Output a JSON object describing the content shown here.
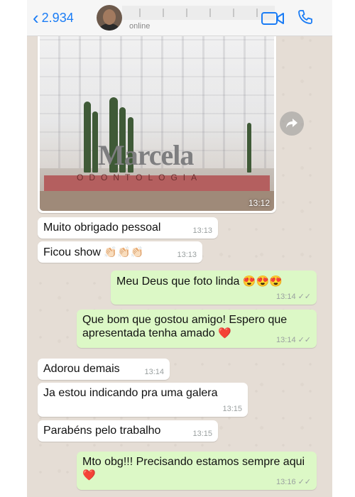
{
  "header": {
    "back_count": "2.934",
    "contact_status": "online",
    "icons": [
      "chevron-left-icon",
      "video-icon",
      "phone-icon"
    ],
    "accent_color": "#1a7cf5"
  },
  "photo": {
    "time": "13:12"
  },
  "messages": [
    {
      "dir": "in",
      "text": "Muito obrigado pessoal",
      "time": "13:13"
    },
    {
      "dir": "in",
      "text": "Ficou show",
      "emoji": "👏🏻👏🏻👏🏻",
      "time": "13:13"
    },
    {
      "dir": "out",
      "text": "Meu Deus que foto linda",
      "emoji": "😍😍😍",
      "time": "13:14"
    },
    {
      "dir": "out",
      "text": "Que bom que gostou amigo! Espero que apresentada tenha amado",
      "emoji": "❤️",
      "time": "13:14"
    },
    {
      "dir": "in",
      "text": "Adorou demais",
      "time": "13:14"
    },
    {
      "dir": "in",
      "text": "Ja estou indicando pra uma galera",
      "time": "13:15"
    },
    {
      "dir": "in",
      "text": "Parabéns pelo trabalho",
      "time": "13:15"
    },
    {
      "dir": "out",
      "text": "Mto obg!!! Precisando estamos sempre aqui",
      "emoji": "❤️",
      "time": "13:16"
    }
  ],
  "colors": {
    "incoming": "#ffffff",
    "outgoing": "#dcf8c6",
    "background": "#e5ddd5"
  }
}
